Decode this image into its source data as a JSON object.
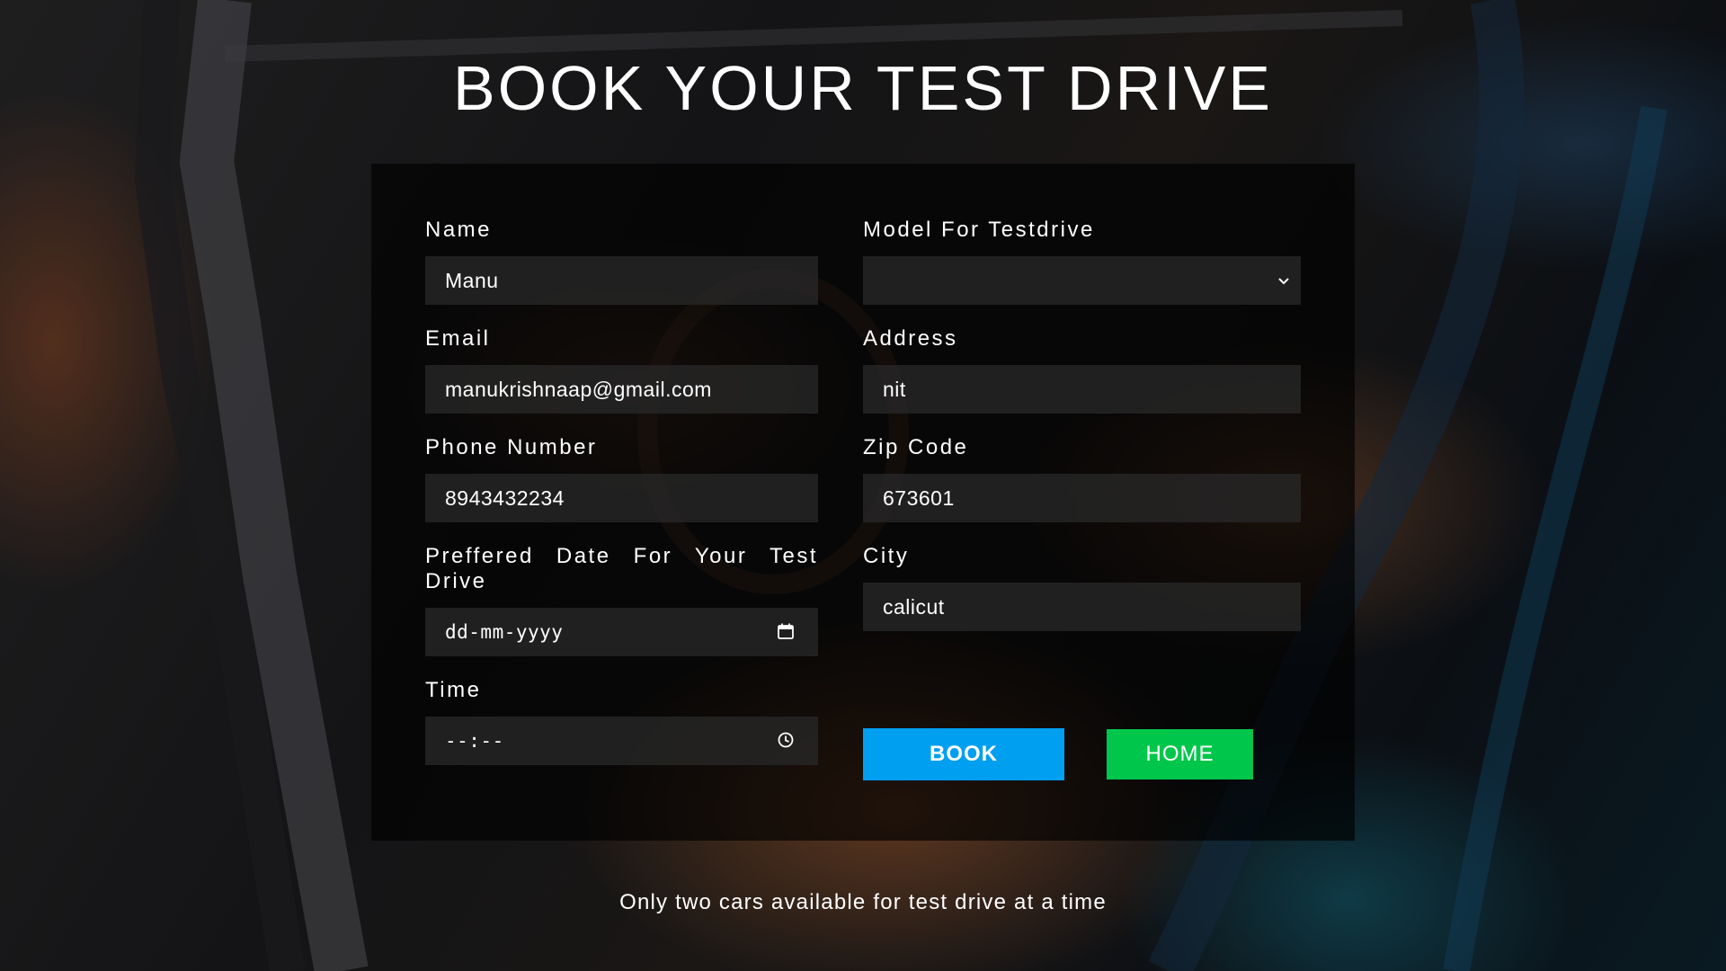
{
  "page": {
    "title": "BOOK YOUR TEST DRIVE",
    "footer_note": "Only two cars available for test drive at a time"
  },
  "form": {
    "name": {
      "label": "Name",
      "value": "Manu"
    },
    "email": {
      "label": "Email",
      "value": "manukrishnaap@gmail.com"
    },
    "phone": {
      "label": "Phone Number",
      "value": "8943432234"
    },
    "date": {
      "label": "Preffered Date For Your Test Drive",
      "placeholder": "dd-mm-yyyy",
      "icon": "calendar-icon"
    },
    "time": {
      "label": "Time",
      "placeholder": "--:--",
      "icon": "clock-icon"
    },
    "model": {
      "label": "Model For Testdrive",
      "value": "",
      "icon": "chevron-down-icon"
    },
    "address": {
      "label": "Address",
      "value": "nit"
    },
    "zip": {
      "label": "Zip Code",
      "value": "673601"
    },
    "city": {
      "label": "City",
      "value": "calicut"
    }
  },
  "buttons": {
    "book": "BOOK",
    "home": "HOME"
  },
  "colors": {
    "book_button": "#009ff0",
    "home_button": "#00c64b",
    "panel": "rgba(0,0,0,0.66)",
    "input_background": "#282828"
  }
}
